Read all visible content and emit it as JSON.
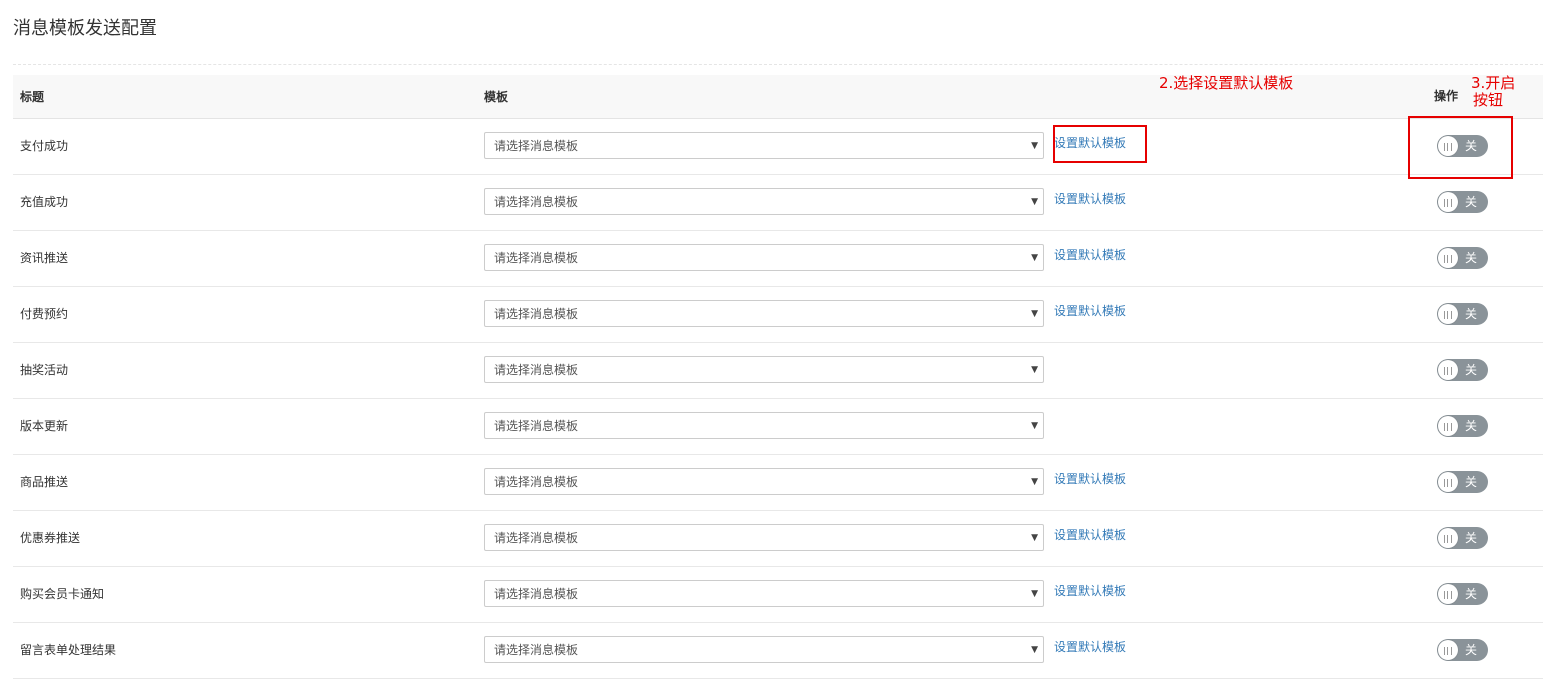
{
  "page": {
    "title": "消息模板发送配置"
  },
  "table": {
    "headers": {
      "title": "标题",
      "template": "模板",
      "action": "操作"
    },
    "rows": [
      {
        "title": "支付成功",
        "select_value": "请选择消息模板",
        "default_link": "设置默认模板",
        "toggle": "关"
      },
      {
        "title": "充值成功",
        "select_value": "请选择消息模板",
        "default_link": "设置默认模板",
        "toggle": "关"
      },
      {
        "title": "资讯推送",
        "select_value": "请选择消息模板",
        "default_link": "设置默认模板",
        "toggle": "关"
      },
      {
        "title": "付费预约",
        "select_value": "请选择消息模板",
        "default_link": "设置默认模板",
        "toggle": "关"
      },
      {
        "title": "抽奖活动",
        "select_value": "请选择消息模板",
        "default_link": null,
        "toggle": "关"
      },
      {
        "title": "版本更新",
        "select_value": "请选择消息模板",
        "default_link": null,
        "toggle": "关"
      },
      {
        "title": "商品推送",
        "select_value": "请选择消息模板",
        "default_link": "设置默认模板",
        "toggle": "关"
      },
      {
        "title": "优惠券推送",
        "select_value": "请选择消息模板",
        "default_link": "设置默认模板",
        "toggle": "关"
      },
      {
        "title": "购买会员卡通知",
        "select_value": "请选择消息模板",
        "default_link": "设置默认模板",
        "toggle": "关"
      },
      {
        "title": "留言表单处理结果",
        "select_value": "请选择消息模板",
        "default_link": "设置默认模板",
        "toggle": "关"
      }
    ]
  },
  "annotations": {
    "step2": "2.选择设置默认模板",
    "step3_line1": "3.开启",
    "step3_line2": "按钮"
  },
  "colors": {
    "annotation": "#e60000",
    "link": "#337ab7",
    "toggle_off": "#8a9399",
    "header_bg": "#f8f8f8"
  },
  "icons": {
    "select_caret": "chevron-down-icon",
    "toggle_knob": "grip-icon"
  }
}
